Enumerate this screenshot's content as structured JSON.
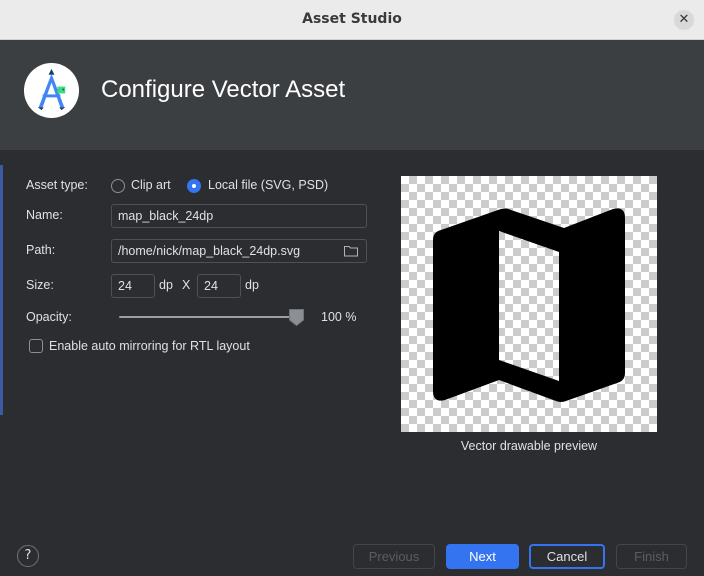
{
  "window": {
    "title": "Asset Studio",
    "close_icon": "close-icon"
  },
  "header": {
    "title": "Configure Vector Asset",
    "logo_icon": "android-studio-logo-icon"
  },
  "form": {
    "asset_type": {
      "label": "Asset type:",
      "options": [
        {
          "label": "Clip art",
          "selected": false
        },
        {
          "label": "Local file (SVG, PSD)",
          "selected": true
        }
      ]
    },
    "name": {
      "label": "Name:",
      "value": "map_black_24dp"
    },
    "path": {
      "label": "Path:",
      "value": "/home/nick/map_black_24dp.svg",
      "browse_icon": "folder-icon"
    },
    "size": {
      "label": "Size:",
      "width": "24",
      "height": "24",
      "unit": "dp",
      "separator": "X"
    },
    "opacity": {
      "label": "Opacity:",
      "value": 100,
      "display": "100 %"
    },
    "auto_mirror": {
      "label": "Enable auto mirroring for RTL layout",
      "checked": false
    }
  },
  "preview": {
    "caption": "Vector drawable preview",
    "icon": "map-icon"
  },
  "footer": {
    "help_label": "?",
    "buttons": {
      "previous": {
        "label": "Previous",
        "enabled": false
      },
      "next": {
        "label": "Next",
        "enabled": true
      },
      "cancel": {
        "label": "Cancel",
        "enabled": true
      },
      "finish": {
        "label": "Finish",
        "enabled": false
      }
    }
  },
  "colors": {
    "accent": "#3574f0",
    "background": "#2b2d30",
    "header_bg": "#3c3f41"
  }
}
